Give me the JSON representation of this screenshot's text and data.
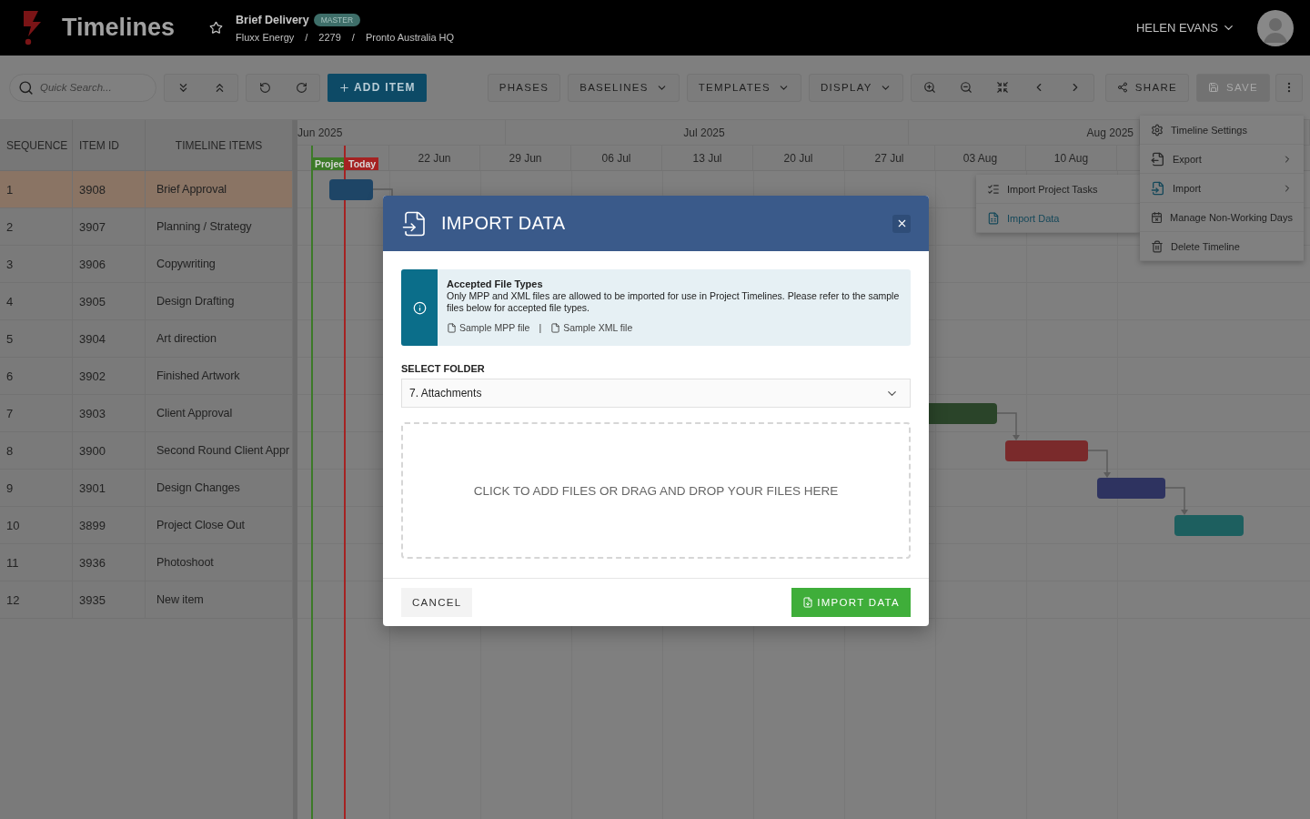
{
  "header": {
    "app_title": "Timelines",
    "project": {
      "title": "Brief Delivery",
      "badge": "MASTER",
      "breadcrumbs": [
        "Fluxx Energy",
        "2279",
        "Pronto Australia HQ"
      ],
      "separator": "/"
    },
    "user": "HELEN EVANS"
  },
  "toolbar": {
    "search": {
      "placeholder": "Quick Search..."
    },
    "add_item": "ADD ITEM",
    "menus": [
      {
        "label": "PHASES",
        "kind": "plain"
      },
      {
        "label": "BASELINES",
        "kind": "dropdown"
      },
      {
        "label": "TEMPLATES",
        "kind": "dropdown"
      },
      {
        "label": "DISPLAY",
        "kind": "dropdown"
      }
    ],
    "share": "SHARE",
    "save": {
      "label": "SAVE",
      "disabled": true
    }
  },
  "table": {
    "columns": [
      "SEQUENCE",
      "ITEM ID",
      "TIMELINE ITEMS"
    ],
    "rows": [
      {
        "sequence": "1",
        "item_id": "3908",
        "name": "Brief Approval",
        "selected": true,
        "bar": {
          "color": "#1e4566"
        }
      },
      {
        "sequence": "2",
        "item_id": "3907",
        "name": "Planning / Strategy",
        "selected": false
      },
      {
        "sequence": "3",
        "item_id": "3906",
        "name": "Copywriting",
        "selected": false
      },
      {
        "sequence": "4",
        "item_id": "3905",
        "name": "Design Drafting",
        "selected": false
      },
      {
        "sequence": "5",
        "item_id": "3904",
        "name": "Art direction",
        "selected": false
      },
      {
        "sequence": "6",
        "item_id": "3902",
        "name": "Finished Artwork",
        "selected": false
      },
      {
        "sequence": "7",
        "item_id": "3903",
        "name": "Client Approval",
        "selected": false,
        "bar": {
          "color": "#2a4429"
        }
      },
      {
        "sequence": "8",
        "item_id": "3900",
        "name": "Second Round Client Appr",
        "selected": false,
        "bar": {
          "color": "#7a2a2b"
        }
      },
      {
        "sequence": "9",
        "item_id": "3901",
        "name": "Design Changes",
        "selected": false,
        "bar": {
          "color": "#2e3360"
        }
      },
      {
        "sequence": "10",
        "item_id": "3899",
        "name": "Project Close Out",
        "selected": false,
        "bar": {
          "color": "#1d5f5f"
        }
      },
      {
        "sequence": "11",
        "item_id": "3936",
        "name": "Photoshoot",
        "selected": false
      },
      {
        "sequence": "12",
        "item_id": "3935",
        "name": "New item",
        "selected": false
      }
    ]
  },
  "gantt": {
    "months": [
      "Jun 2025",
      "Jul 2025",
      "Aug 2025"
    ],
    "weeks": [
      "22 Jun",
      "29 Jun",
      "06 Jul",
      "13 Jul",
      "20 Jul",
      "27 Jul",
      "03 Aug",
      "10 Aug"
    ],
    "markers": [
      {
        "label": "Projec",
        "color": "#3c7a28"
      },
      {
        "label": "Today",
        "color": "#a52222"
      }
    ]
  },
  "settings_menu": {
    "items": [
      {
        "label": "Timeline Settings",
        "kind": "settings",
        "submenu": false,
        "selected": false
      },
      {
        "label": "Export",
        "kind": "export",
        "submenu": true,
        "selected": false
      },
      {
        "label": "Import",
        "kind": "import",
        "submenu": true,
        "selected": true
      },
      {
        "label": "Manage Non-Working Days",
        "kind": "days",
        "submenu": false,
        "selected": false
      },
      {
        "label": "Delete Timeline",
        "kind": "delete",
        "submenu": false,
        "selected": false
      }
    ],
    "import_submenu": [
      {
        "label": "Import Project Tasks",
        "kind": "tasks",
        "selected": false
      },
      {
        "label": "Import Data",
        "kind": "data",
        "selected": true
      }
    ]
  },
  "modal": {
    "title": "IMPORT DATA",
    "info": {
      "title": "Accepted File Types",
      "text": "Only MPP and XML files are allowed to be imported for use in Project Timelines. Please refer to the sample files below for accepted file types.",
      "links": [
        "Sample MPP file",
        "Sample XML file"
      ],
      "separator": "|"
    },
    "folder": {
      "label": "SELECT FOLDER",
      "value": "7. Attachments"
    },
    "dropzone": "CLICK TO ADD FILES OR DRAG AND DROP YOUR FILES HERE",
    "cancel": "CANCEL",
    "submit": "IMPORT DATA"
  }
}
